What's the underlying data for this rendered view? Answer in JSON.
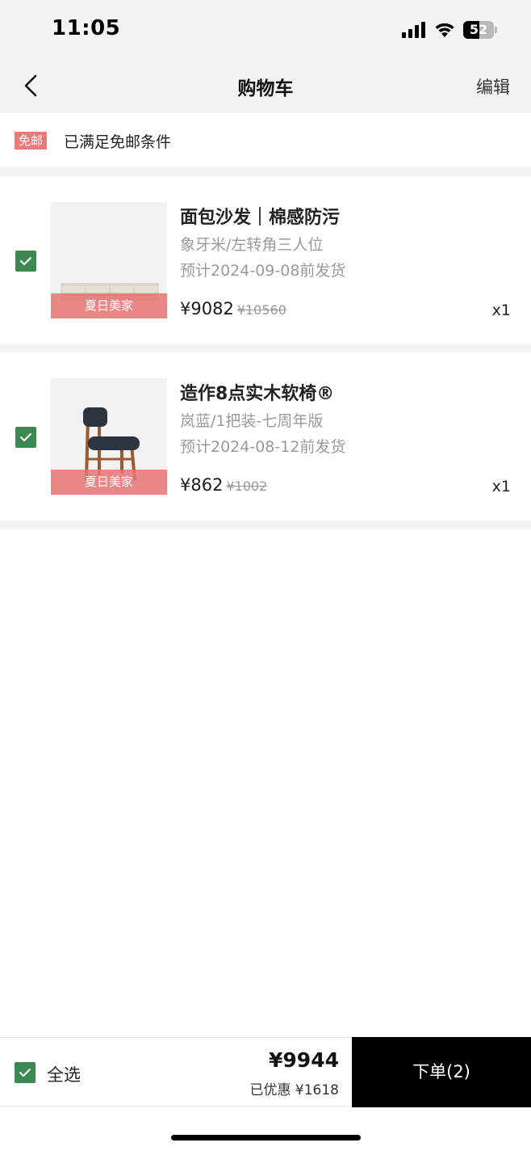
{
  "status_bar": {
    "time": "11:05",
    "battery": "52",
    "battery_level": 0.52
  },
  "nav": {
    "title": "购物车",
    "edit_label": "编辑"
  },
  "shipping": {
    "tag": "免邮",
    "text": "已满足免邮条件"
  },
  "items": [
    {
      "name": "面包沙发｜棉感防污",
      "spec": "象牙米/左转角三人位",
      "ship_date": "预计2024-09-08前发货",
      "price": "¥9082",
      "original_price": "¥10560",
      "quantity": "x1",
      "promo": "夏日美家",
      "selected": true
    },
    {
      "name": "造作8点实木软椅®",
      "spec": "岚蓝/1把装-七周年版",
      "ship_date": "预计2024-08-12前发货",
      "price": "¥862",
      "original_price": "¥1002",
      "quantity": "x1",
      "promo": "夏日美家",
      "selected": true
    }
  ],
  "footer": {
    "select_all_label": "全选",
    "total": "¥9944",
    "discount_label": "已优惠",
    "discount_value": "¥1618",
    "submit_label": "下单(2)"
  },
  "colors": {
    "accent_green": "#3c8a52",
    "promo_red": "#e87a78",
    "submit_black": "#000000"
  }
}
